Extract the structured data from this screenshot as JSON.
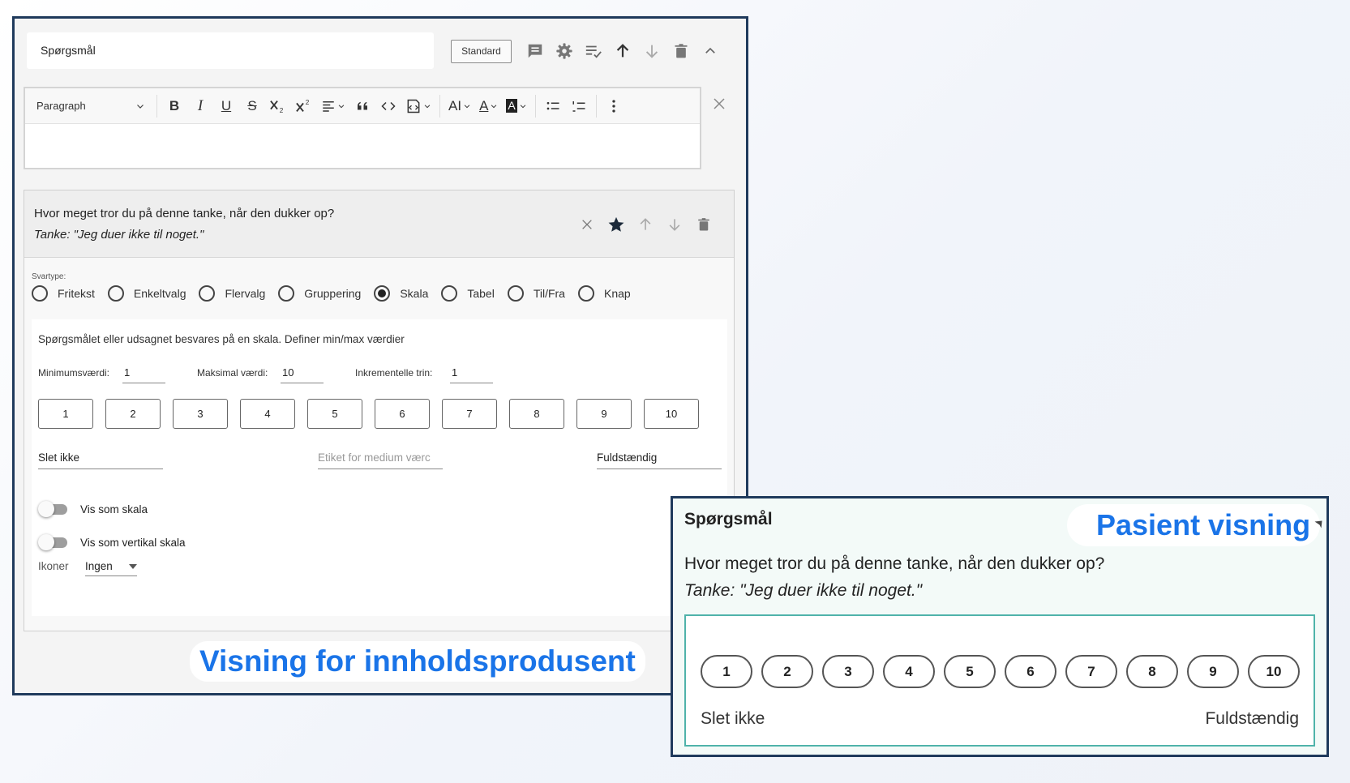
{
  "editor": {
    "question_title": "Spørgsmål",
    "standard_label": "Standard",
    "toolbar": {
      "paragraph_label": "Paragraph",
      "bold": "B",
      "italic": "I",
      "underline": "U",
      "strike": "S",
      "font_size": "AI",
      "font_color": "A",
      "highlight": "A"
    },
    "question": {
      "text": "Hvor meget tror du på denne tanke, når den dukker op?",
      "subtext": "Tanke: \"Jeg duer ikke til noget.\""
    },
    "answer_type_label": "Svartype:",
    "answer_types": [
      {
        "label": "Fritekst",
        "selected": false
      },
      {
        "label": "Enkeltvalg",
        "selected": false
      },
      {
        "label": "Flervalg",
        "selected": false
      },
      {
        "label": "Gruppering",
        "selected": false
      },
      {
        "label": "Skala",
        "selected": true
      },
      {
        "label": "Tabel",
        "selected": false
      },
      {
        "label": "Til/Fra",
        "selected": false
      },
      {
        "label": "Knap",
        "selected": false
      }
    ],
    "scale": {
      "description": "Spørgsmålet eller udsagnet besvares på en skala. Definer min/max værdier",
      "min_label": "Minimumsværdi:",
      "min_value": "1",
      "max_label": "Maksimal værdi:",
      "max_value": "10",
      "step_label": "Inkrementelle trin:",
      "step_value": "1",
      "values": [
        "1",
        "2",
        "3",
        "4",
        "5",
        "6",
        "7",
        "8",
        "9",
        "10"
      ],
      "label_min": "Slet ikke",
      "label_medium_placeholder": "Etiket for medium værc",
      "label_max": "Fuldstændig",
      "toggle_scale": "Vis som skala",
      "toggle_vertical": "Vis som vertikal skala",
      "icons_label": "Ikoner",
      "icons_value": "Ingen"
    },
    "caption": "Visning for innholdsprodusent"
  },
  "patient": {
    "title": "Spørgsmål",
    "caption": "Pasient visning",
    "question": "Hvor meget tror du på denne tanke, når den dukker op?",
    "subtext": "Tanke: \"Jeg duer ikke til noget.\"",
    "values": [
      "1",
      "2",
      "3",
      "4",
      "5",
      "6",
      "7",
      "8",
      "9",
      "10"
    ],
    "label_min": "Slet ikke",
    "label_max": "Fuldstændig"
  },
  "colors": {
    "caption_blue": "#1a74e8",
    "frame_navy": "#1f3a5c",
    "preview_teal": "#4fb3aa"
  }
}
